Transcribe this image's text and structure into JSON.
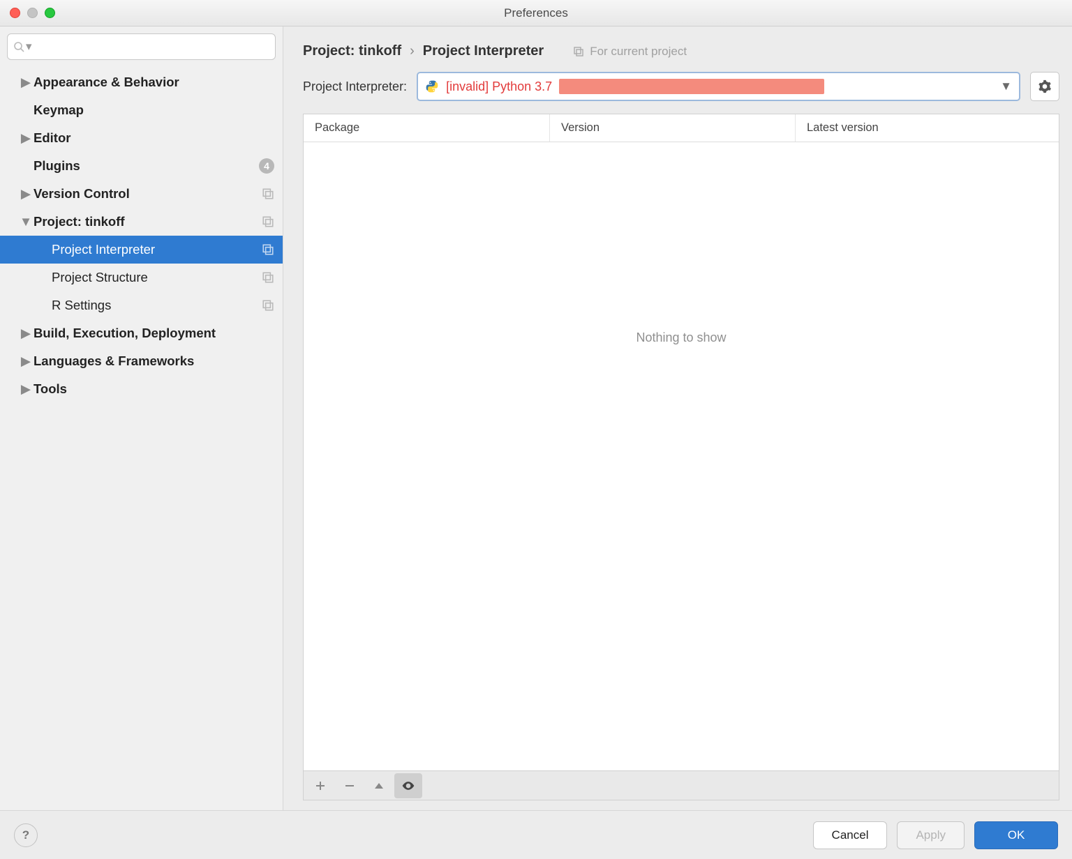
{
  "window": {
    "title": "Preferences"
  },
  "sidebar": {
    "items": [
      {
        "label": "Appearance & Behavior",
        "expandable": true,
        "expanded": false
      },
      {
        "label": "Keymap",
        "expandable": false
      },
      {
        "label": "Editor",
        "expandable": true,
        "expanded": false
      },
      {
        "label": "Plugins",
        "expandable": false,
        "badge": "4"
      },
      {
        "label": "Version Control",
        "expandable": true,
        "expanded": false,
        "meta": true
      },
      {
        "label": "Project: tinkoff",
        "expandable": true,
        "expanded": true,
        "meta": true
      },
      {
        "label": "Project Interpreter",
        "child": true,
        "selected": true,
        "meta": true
      },
      {
        "label": "Project Structure",
        "child": true,
        "meta": true
      },
      {
        "label": "R Settings",
        "child": true,
        "meta": true
      },
      {
        "label": "Build, Execution, Deployment",
        "expandable": true,
        "expanded": false
      },
      {
        "label": "Languages & Frameworks",
        "expandable": true,
        "expanded": false
      },
      {
        "label": "Tools",
        "expandable": true,
        "expanded": false
      }
    ]
  },
  "main": {
    "breadcrumb": [
      "Project: tinkoff",
      "Project Interpreter"
    ],
    "hint": "For current project",
    "interpreter": {
      "label": "Project Interpreter:",
      "value": "[invalid] Python 3.7"
    },
    "table": {
      "headers": [
        "Package",
        "Version",
        "Latest version"
      ],
      "empty": "Nothing to show"
    }
  },
  "footer": {
    "cancel": "Cancel",
    "apply": "Apply",
    "ok": "OK"
  }
}
